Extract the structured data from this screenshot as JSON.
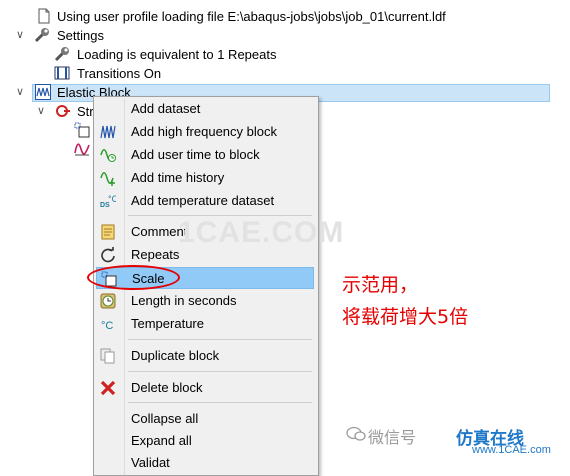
{
  "tree": {
    "profile_label": "Using user profile loading file E:\\abaqus-jobs\\jobs\\job_01\\current.ldf",
    "settings_label": "Settings",
    "loading_label": "Loading is equivalent to 1 Repeats",
    "transitions_label": "Transitions On",
    "elastic_label": "Elastic Block",
    "stress_label": "Stre"
  },
  "menu": {
    "add_dataset": "Add dataset",
    "add_hf_block": "Add high frequency block",
    "add_user_time": "Add user time to block",
    "add_time_history": "Add time history",
    "add_temp_dataset": "Add temperature dataset",
    "comment": "Comment",
    "repeats": "Repeats",
    "scale": "Scale",
    "length_seconds": "Length in seconds",
    "temperature": "Temperature",
    "duplicate_block": "Duplicate block",
    "delete_block": "Delete block",
    "collapse_all": "Collapse all",
    "expand_all": "Expand all",
    "validate_partial": "Validat"
  },
  "annotation": {
    "line1": "示范用，",
    "line2": "将载荷增大5倍"
  },
  "watermark": {
    "center": "1CAE.COM",
    "wechat": "微信号",
    "brand": "仿真在线",
    "url": "www.1CAE.com"
  },
  "colors": {
    "highlight": "#91c9f7",
    "selection": "#cce4f7",
    "annotation": "#e60000"
  }
}
